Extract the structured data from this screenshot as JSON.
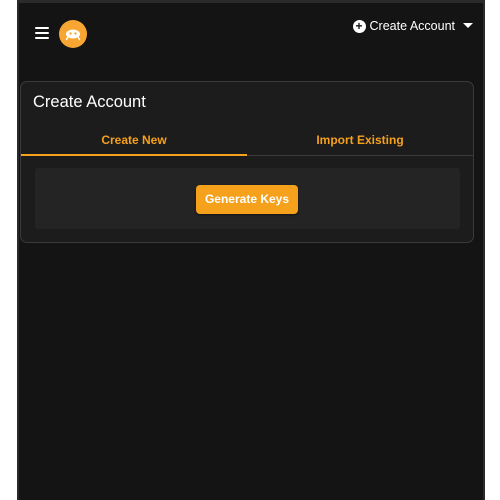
{
  "header": {
    "account_button_label": "Create Account",
    "icons": [
      "menu-icon",
      "logo-icon",
      "plus-circle-icon",
      "caret-down-icon"
    ]
  },
  "card": {
    "title": "Create Account",
    "tabs": [
      {
        "label": "Create New",
        "active": true
      },
      {
        "label": "Import Existing",
        "active": false
      }
    ],
    "generate_button_label": "Generate Keys"
  },
  "colors": {
    "accent": "#f5a11c",
    "background": "#141414",
    "card": "#1c1c1c",
    "panel": "#242424"
  }
}
